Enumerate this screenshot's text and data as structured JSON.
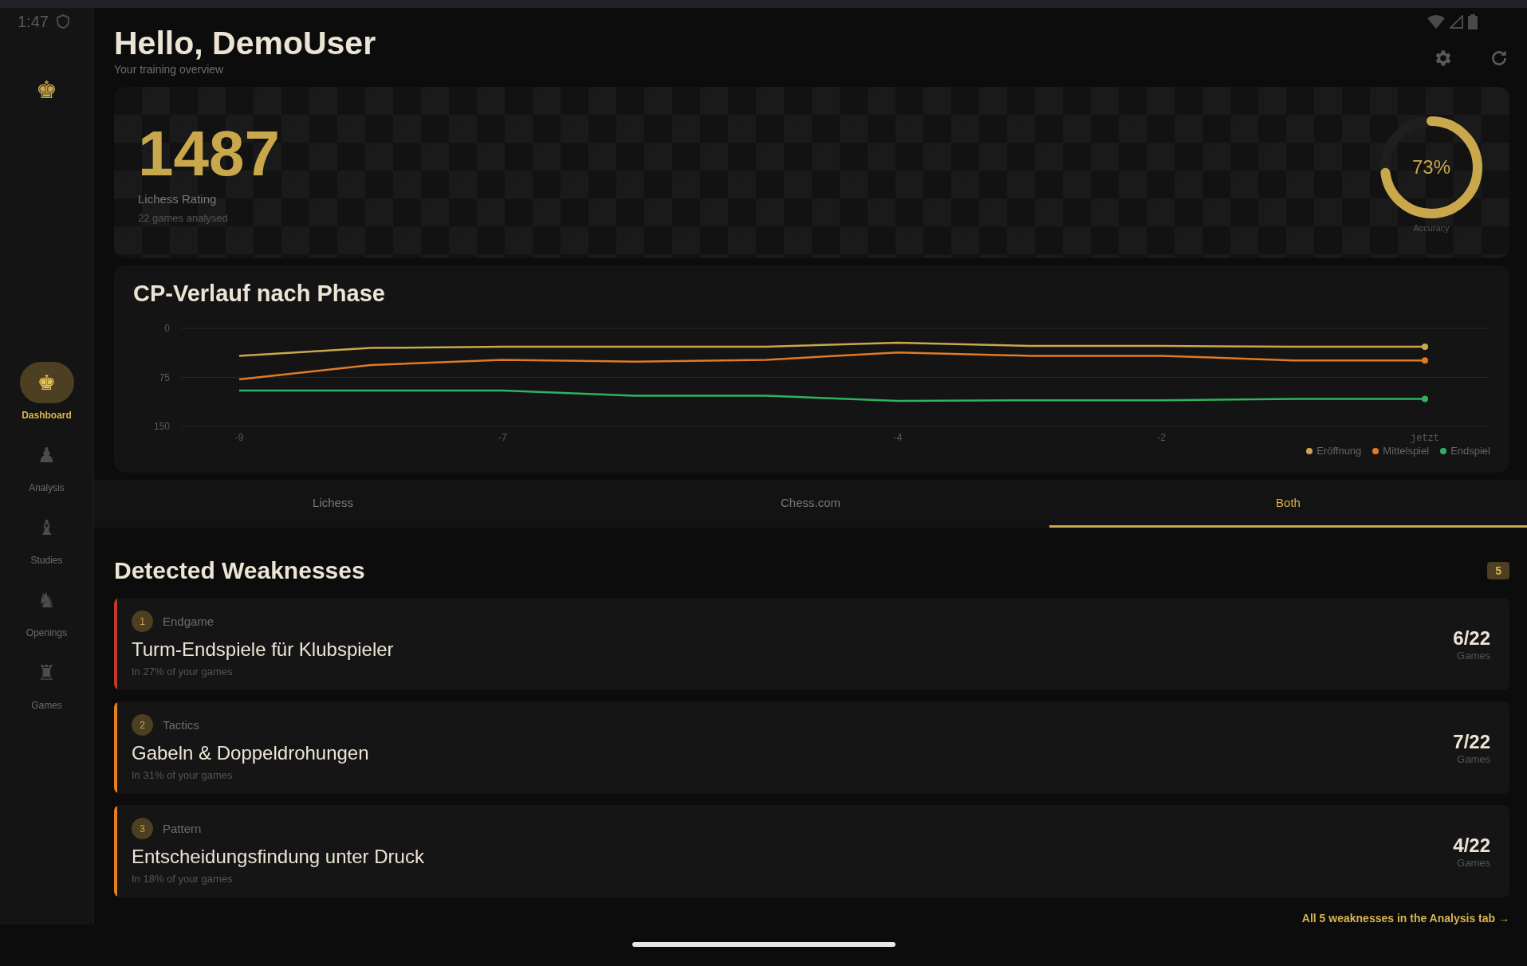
{
  "status_bar": {
    "time": "1:47"
  },
  "sidebar": {
    "logo": "♚",
    "items": [
      {
        "icon": "♚",
        "label": "Dashboard",
        "selected": true
      },
      {
        "icon": "♟",
        "label": "Analysis",
        "selected": false
      },
      {
        "icon": "♝",
        "label": "Studies",
        "selected": false
      },
      {
        "icon": "♞",
        "label": "Openings",
        "selected": false
      },
      {
        "icon": "♜",
        "label": "Games",
        "selected": false
      }
    ]
  },
  "header": {
    "title": "Hello, DemoUser",
    "subtitle": "Your training overview"
  },
  "hero": {
    "rating": "1487",
    "rating_label": "Lichess Rating",
    "games": "22 games analysed",
    "accuracy": {
      "reading": "73%",
      "label": "Accuracy",
      "level": 0.73
    }
  },
  "chart_card": {
    "title": "CP-Verlauf nach Phase",
    "chart_data": {
      "type": "line",
      "categories": [
        "-9",
        null,
        "-7",
        null,
        null,
        "-4",
        null,
        "-2",
        null,
        "jetzt"
      ],
      "ylim": [
        150,
        0
      ],
      "yticks": [
        0,
        75,
        150
      ],
      "series": [
        {
          "name": "Eröffnung",
          "color": "#c9a84c",
          "values": [
            42,
            30,
            28,
            28,
            28,
            22,
            27,
            27,
            28,
            28
          ]
        },
        {
          "name": "Mittelspiel",
          "color": "#e07a26",
          "values": [
            78,
            56,
            48,
            51,
            48,
            37,
            42,
            42,
            49,
            49
          ]
        },
        {
          "name": "Endspiel",
          "color": "#2fb35f",
          "values": [
            95,
            95,
            95,
            103,
            103,
            111,
            110,
            110,
            108,
            108
          ]
        }
      ]
    }
  },
  "tabs": [
    {
      "label": "Lichess",
      "selected": false
    },
    {
      "label": "Chess.com",
      "selected": false
    },
    {
      "label": "Both",
      "selected": true
    }
  ],
  "weaknesses": {
    "title": "Detected Weaknesses",
    "count": "5",
    "items": [
      {
        "rank": "1",
        "category": "Endgame",
        "title": "Turm-Endspiele für Klubspieler",
        "share": "In 27% of your games",
        "ratio": "6/22",
        "unit": "Games",
        "color": "#c0392b"
      },
      {
        "rank": "2",
        "category": "Tactics",
        "title": "Gabeln & Doppeldrohungen",
        "share": "In 31% of your games",
        "ratio": "7/22",
        "unit": "Games",
        "color": "#e67e22"
      },
      {
        "rank": "3",
        "category": "Pattern",
        "title": "Entscheidungsfindung unter Druck",
        "share": "In 18% of your games",
        "ratio": "4/22",
        "unit": "Games",
        "color": "#e67e22"
      }
    ],
    "link": "All 5 weaknesses in the Analysis tab →"
  }
}
